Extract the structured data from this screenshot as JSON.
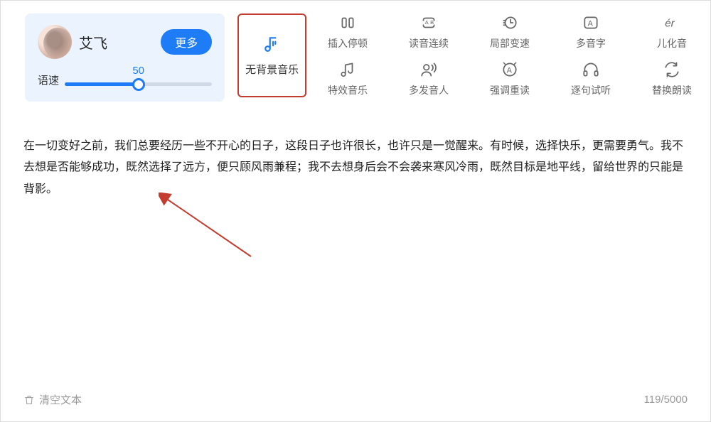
{
  "voice": {
    "name": "艾飞",
    "more_label": "更多",
    "speed_label": "语速",
    "speed_value": "50"
  },
  "bgm": {
    "label": "无背景音乐"
  },
  "tools": {
    "row1": [
      {
        "label": "插入停顿"
      },
      {
        "label": "读音连续"
      },
      {
        "label": "局部变速"
      },
      {
        "label": "多音字"
      },
      {
        "label": "儿化音"
      }
    ],
    "row2": [
      {
        "label": "特效音乐"
      },
      {
        "label": "多发音人"
      },
      {
        "label": "强调重读"
      },
      {
        "label": "逐句试听"
      },
      {
        "label": "替换朗读"
      }
    ]
  },
  "text": "在一切变好之前，我们总要经历一些不开心的日子，这段日子也许很长，也许只是一觉醒来。有时候，选择快乐，更需要勇气。我不去想是否能够成功，既然选择了远方，便只顾风雨兼程；我不去想身后会不会袭来寒风冷雨，既然目标是地平线，留给世界的只能是背影。",
  "footer": {
    "clear_label": "清空文本",
    "count": "119/5000"
  }
}
